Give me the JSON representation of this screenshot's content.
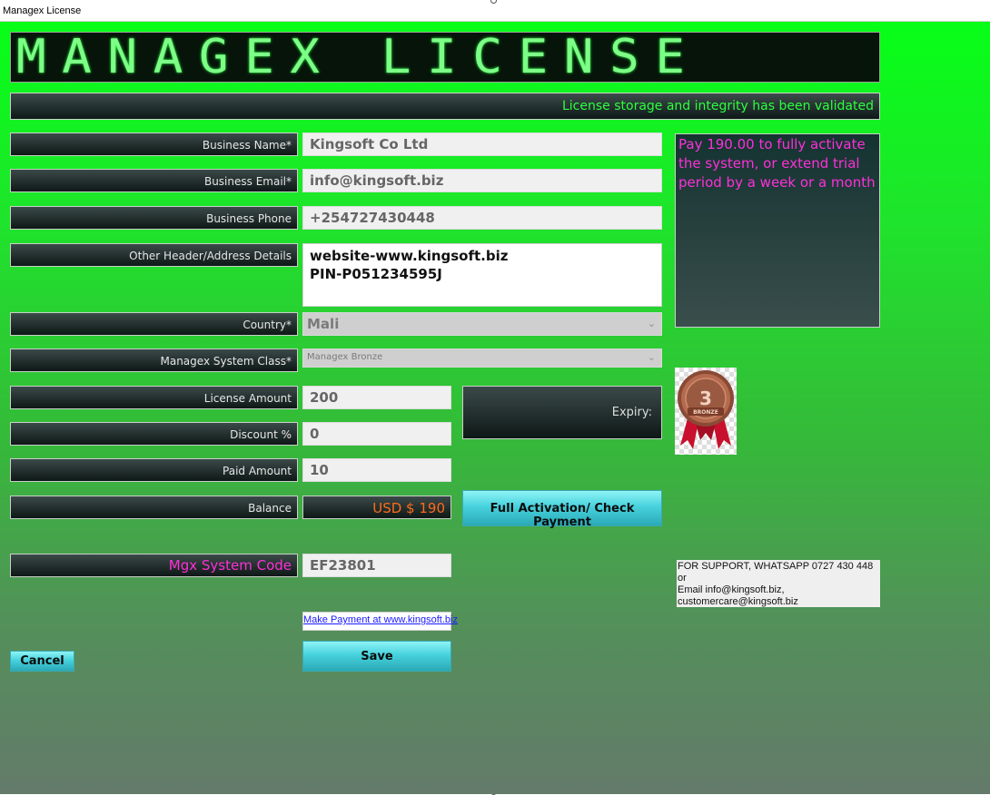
{
  "window": {
    "title": "Managex License"
  },
  "banner": {
    "text": "MANAGEX LICENSE"
  },
  "status_message": "License storage and integrity has been validated",
  "form": {
    "business_name": {
      "label": "Business Name*",
      "value": "Kingsoft Co Ltd"
    },
    "business_email": {
      "label": "Business Email*",
      "value": "info@kingsoft.biz"
    },
    "business_phone": {
      "label": "Business Phone",
      "value": "+254727430448"
    },
    "other_details": {
      "label": "Other Header/Address Details",
      "line1": "website-www.kingsoft.biz",
      "line2": "PIN-P051234595J"
    },
    "country": {
      "label": "Country*",
      "value": "Mali"
    },
    "system_class": {
      "label": "Managex System Class*",
      "value": "Managex Bronze"
    },
    "license_amount": {
      "label": "License Amount",
      "value": "200"
    },
    "discount": {
      "label": "Discount %",
      "value": "0"
    },
    "paid_amount": {
      "label": "Paid Amount",
      "value": "10"
    },
    "balance": {
      "label": "Balance",
      "value": "USD $ 190"
    },
    "system_code": {
      "label": "Mgx System Code",
      "value": "EF23801"
    }
  },
  "activation_note": "Pay 190.00 to fully activate the system, or extend trial period by a week or a month",
  "expiry": {
    "label": "Expiry:"
  },
  "badge": {
    "text": "BRONZE",
    "number": "3"
  },
  "buttons": {
    "full_activation": "Full Activation/ Check Payment",
    "save": "Save",
    "cancel": "Cancel"
  },
  "payment_link": "Make Payment at www.kingsoft.biz",
  "support": {
    "line1": "FOR SUPPORT, WHATSAPP 0727 430 448 or",
    "line2": "Email info@kingsoft.biz,",
    "line3": "customercare@kingsoft.biz"
  },
  "colors": {
    "background_top": "#07ff17",
    "background_bottom": "#647a6a",
    "status_text": "#2cff3e",
    "note_text": "#ff2fd9",
    "balance_text": "#ff6a1a",
    "code_label": "#ff2fd9"
  }
}
